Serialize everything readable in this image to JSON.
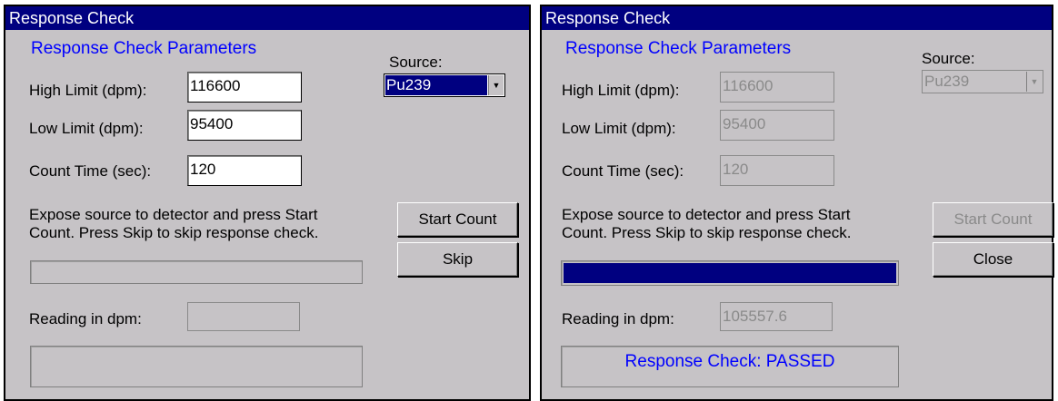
{
  "left": {
    "title": "Response Check",
    "heading": "Response Check Parameters",
    "source_label": "Source:",
    "source_value": "Pu239",
    "high_label": "High Limit (dpm):",
    "high_value": "116600",
    "low_label": "Low Limit (dpm):",
    "low_value": "95400",
    "count_label": "Count Time (sec):",
    "count_value": "120",
    "instructions_line1": "Expose source to detector and press Start",
    "instructions_line2": "Count.  Press Skip to skip response check.",
    "start_button": "Start Count",
    "second_button": "Skip",
    "progress": 0,
    "reading_label": "Reading in dpm:",
    "reading_value": "",
    "status": ""
  },
  "right": {
    "title": "Response Check",
    "heading": "Response Check Parameters",
    "source_label": "Source:",
    "source_value": "Pu239",
    "high_label": "High Limit (dpm):",
    "high_value": "116600",
    "low_label": "Low Limit (dpm):",
    "low_value": "95400",
    "count_label": "Count Time (sec):",
    "count_value": "120",
    "instructions_line1": "Expose source to detector and press Start",
    "instructions_line2": "Count.  Press Skip to skip response check.",
    "start_button": "Start Count",
    "second_button": "Close",
    "progress": 1,
    "reading_label": "Reading in dpm:",
    "reading_value": "105557.6",
    "status": "Response Check: PASSED"
  },
  "colors": {
    "titlebar": "#000080",
    "window_bg": "#c6c3c6",
    "heading_text": "#0000ff",
    "progress_fill": "#000080"
  },
  "icons": {
    "dropdown": "triangle-down"
  }
}
